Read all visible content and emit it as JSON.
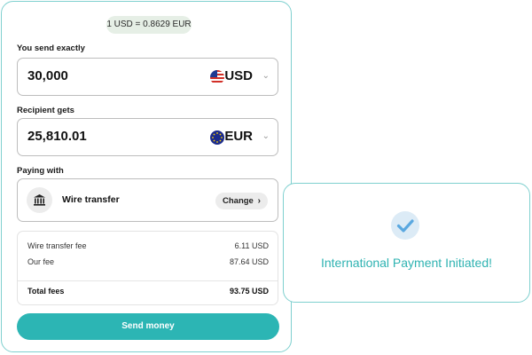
{
  "rate": {
    "text": "1 USD = 0.8629 EUR"
  },
  "send": {
    "label": "You send exactly",
    "amount": "30,000",
    "currency": "USD",
    "flag_icon": "us-flag-icon"
  },
  "receive": {
    "label": "Recipient gets",
    "amount": "25,810.01",
    "currency": "EUR",
    "flag_icon": "eu-flag-icon"
  },
  "paying": {
    "label": "Paying with",
    "method": "Wire transfer",
    "method_icon": "bank-icon",
    "change_label": "Change"
  },
  "fees": {
    "rows": [
      {
        "label": "Wire transfer fee",
        "value": "6.11 USD"
      },
      {
        "label": "Our fee",
        "value": "87.64 USD"
      }
    ],
    "total": {
      "label": "Total fees",
      "value": "93.75 USD"
    }
  },
  "action": {
    "send_label": "Send money"
  },
  "success": {
    "message": "International Payment Initiated!",
    "icon": "check-circle-icon"
  },
  "colors": {
    "accent": "#2cb5b4",
    "border": "#7fd0cf",
    "check": "#5aa8e0"
  }
}
